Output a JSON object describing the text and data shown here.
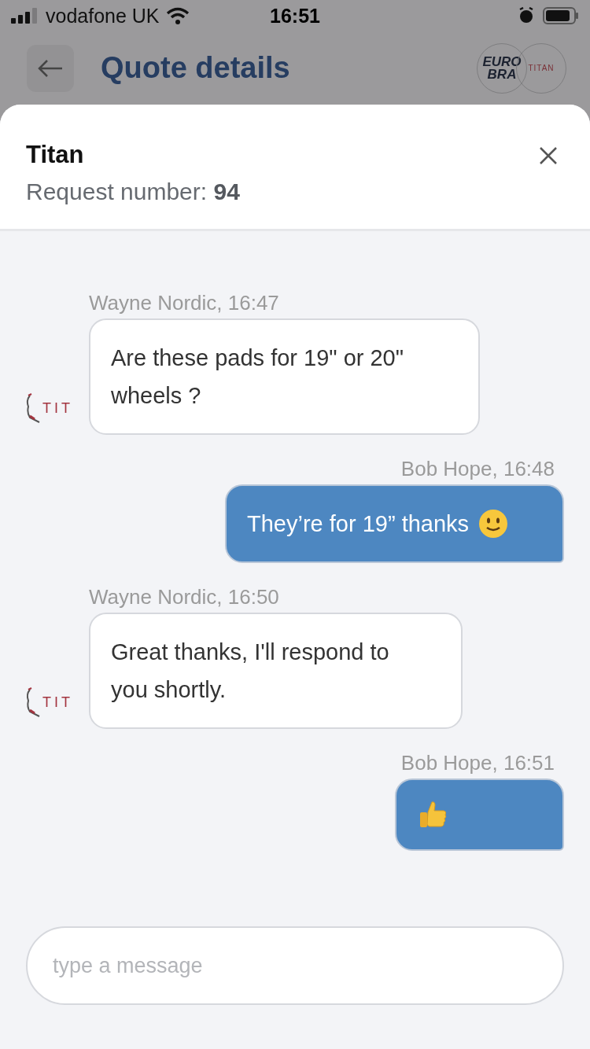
{
  "status_bar": {
    "carrier": "vodafone UK",
    "time": "16:51"
  },
  "header": {
    "title": "Quote details",
    "logo_left_lines": [
      "EURO",
      "BRA"
    ],
    "logo_right": "TITAN"
  },
  "sheet": {
    "title": "Titan",
    "subtitle": "Request number: **94**"
  },
  "messages": [
    {
      "kind": "incoming",
      "author": "Wayne Nordic, 16:47",
      "text": "Are these pads for 19\" or 20\" wheels ?",
      "avatar_text": "TIT"
    },
    {
      "kind": "outgoing",
      "author": "Bob Hope, 16:48",
      "text": "They’re for 19” thanks",
      "emoji": {
        "kind": "smile"
      }
    },
    {
      "kind": "incoming",
      "author": "Wayne Nordic, 16:50",
      "text": "Great thanks, I'll respond to you shortly.",
      "avatar_text": "TIT"
    },
    {
      "kind": "outgoing",
      "author": "Bob Hope, 16:51",
      "emoji": {
        "kind": "thumbs-up"
      }
    }
  ],
  "composer": {
    "placeholder": "type a message"
  }
}
